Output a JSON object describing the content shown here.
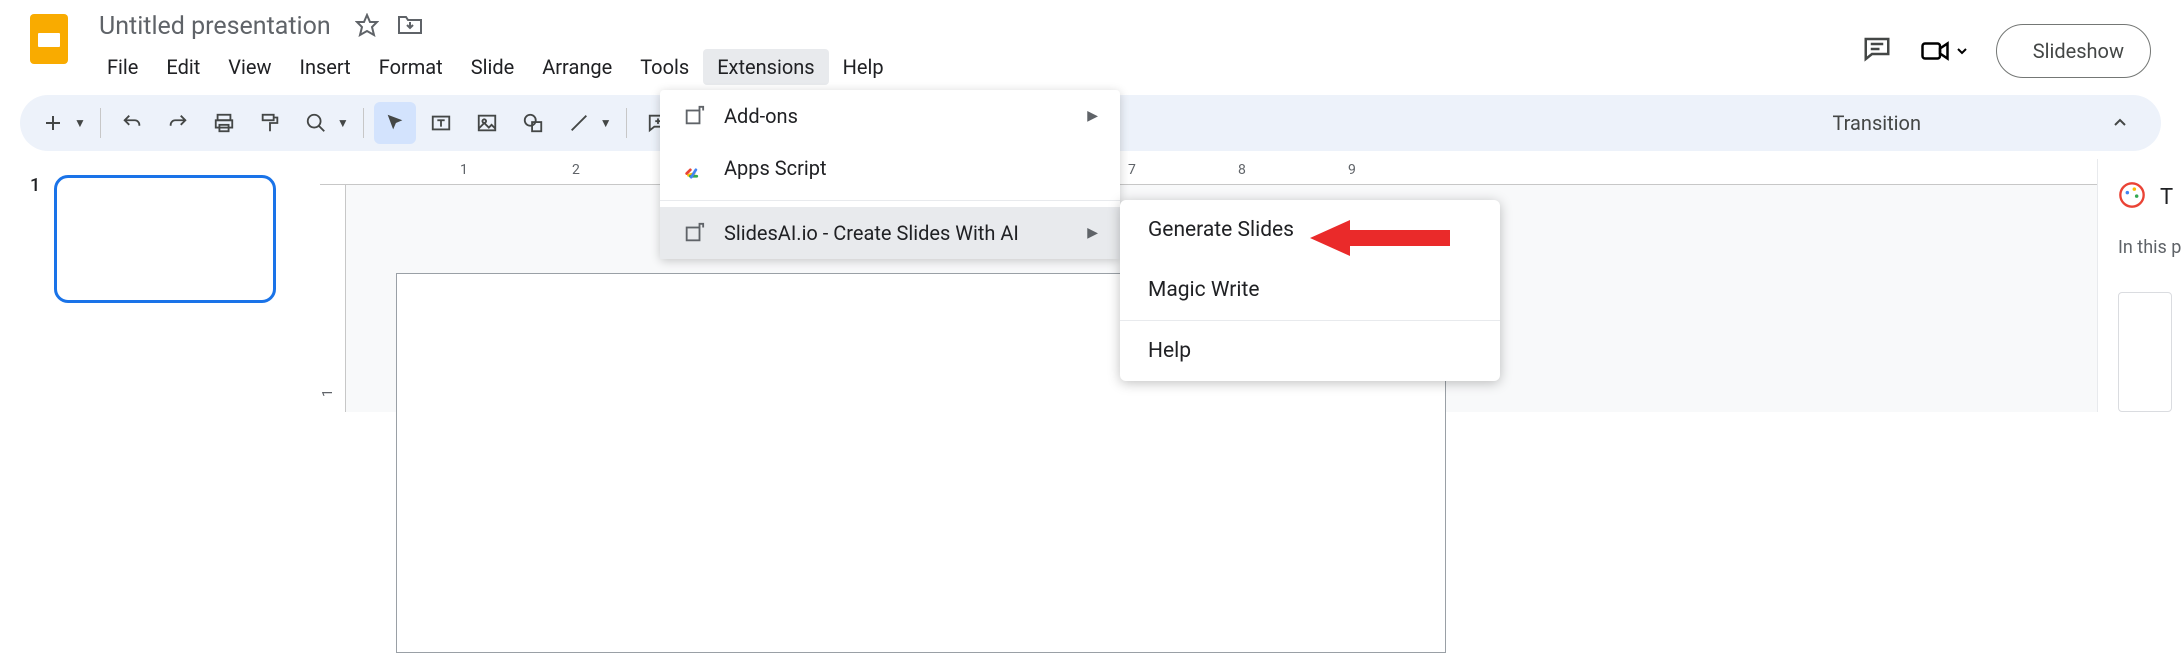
{
  "header": {
    "doc_title": "Untitled presentation",
    "slideshow_button": "Slideshow"
  },
  "menu": {
    "file": "File",
    "edit": "Edit",
    "view": "View",
    "insert": "Insert",
    "format": "Format",
    "slide": "Slide",
    "arrange": "Arrange",
    "tools": "Tools",
    "extensions": "Extensions",
    "help": "Help"
  },
  "toolbar": {
    "transition": "Transition"
  },
  "slides": {
    "current_number": "1"
  },
  "ruler": {
    "h_labels": [
      "1",
      "2",
      "7",
      "8",
      "9"
    ],
    "v_labels": [
      "1"
    ]
  },
  "right_panel": {
    "title_fragment": "T",
    "subtitle_fragment": "In this pr"
  },
  "extensions_menu": {
    "addons": "Add-ons",
    "apps_script": "Apps Script",
    "slidesai": "SlidesAI.io - Create Slides With AI"
  },
  "slidesai_submenu": {
    "generate": "Generate Slides",
    "magic_write": "Magic Write",
    "help": "Help"
  }
}
